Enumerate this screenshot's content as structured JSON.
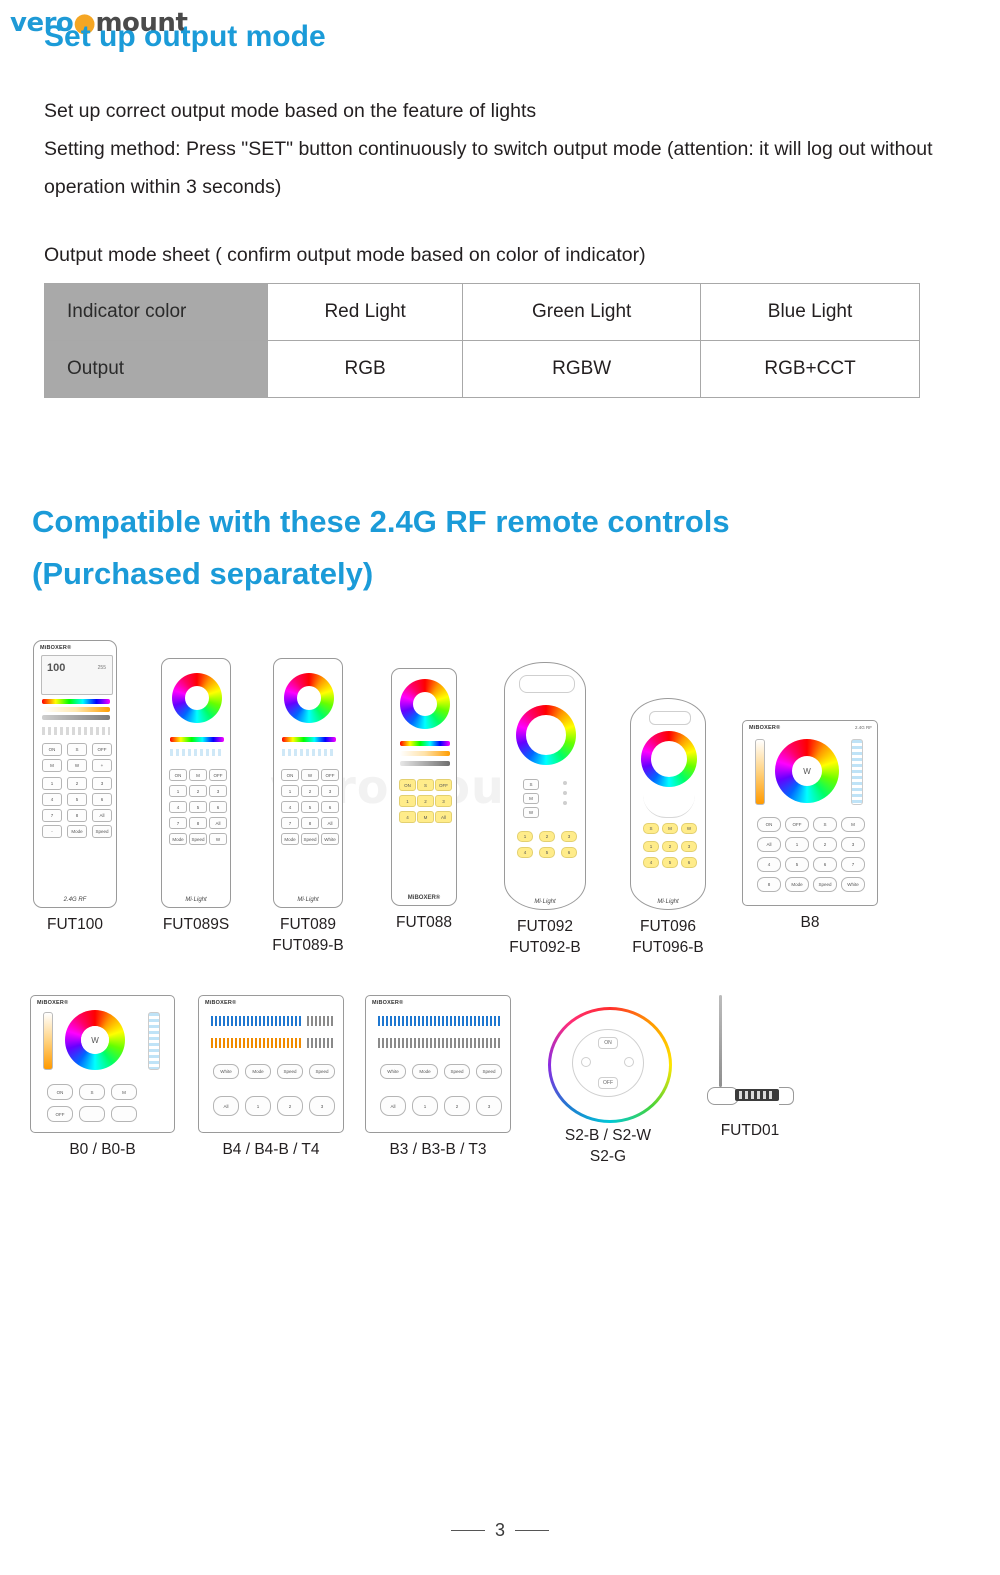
{
  "logo": {
    "part1": "vero",
    "dot": "●",
    "part2": "mount"
  },
  "section": {
    "title": "Set up output mode",
    "paragraph1": "Set up correct output mode based on the feature of lights\nSetting method: Press \"SET\" button continuously to switch output mode (attention: it will log out without operation within 3 seconds)",
    "paragraph2": "Output mode sheet ( confirm output mode based on color of indicator)"
  },
  "mode_table": {
    "rows": [
      {
        "head": "Indicator color",
        "cells": [
          "Red Light",
          "Green Light",
          "Blue Light"
        ]
      },
      {
        "head": "Output",
        "cells": [
          "RGB",
          "RGBW",
          "RGB+CCT"
        ]
      }
    ]
  },
  "compat_heading": "Compatible with these 2.4G RF remote controls\n(Purchased separately)",
  "watermark": "veromount",
  "products": {
    "row1": [
      {
        "name": "FUT100"
      },
      {
        "name": "FUT089S"
      },
      {
        "name": "FUT089\nFUT089-B"
      },
      {
        "name": "FUT088"
      },
      {
        "name": "FUT092\nFUT092-B"
      },
      {
        "name": "FUT096\nFUT096-B"
      },
      {
        "name": "B8"
      }
    ],
    "row2": [
      {
        "name": "B0 / B0-B"
      },
      {
        "name": "B4 / B4-B / T4"
      },
      {
        "name": "B3 / B3-B / T3"
      },
      {
        "name": "S2-B / S2-W\nS2-G"
      },
      {
        "name": "FUTD01"
      }
    ]
  },
  "device_brands": {
    "miboxer": "MiBOXER®",
    "milight": "Mi·Light",
    "rf": "2.4G RF"
  },
  "device_keys": {
    "on": "ON",
    "off": "OFF",
    "s": "S",
    "m": "M",
    "w": "W",
    "plus": "+",
    "minus": "-",
    "n1": "1",
    "n2": "2",
    "n3": "3",
    "n4": "4",
    "n5": "5",
    "n6": "6",
    "n7": "7",
    "n8": "8",
    "all": "All",
    "mode": "Mode",
    "speed": "Speed",
    "white": "White",
    "lcd_value": "100",
    "lcd_sub": "255"
  },
  "footer": {
    "page": "3"
  }
}
